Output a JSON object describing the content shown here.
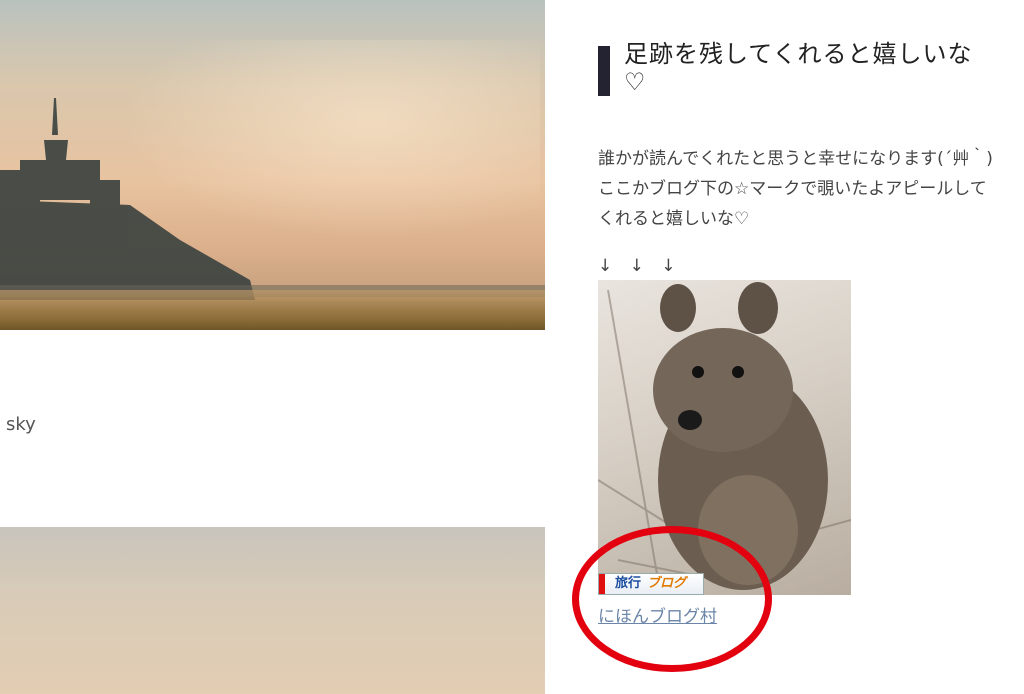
{
  "post": {
    "caption": "sky"
  },
  "sidebar": {
    "title": "足跡を残してくれると嬉しいな♡",
    "paragraph1": "誰かが読んでくれたと思うと幸せになります(´艸｀)",
    "paragraph2": "ここかブログ下の☆マークで覗いたよアピールしてくれると嬉しいな♡",
    "arrows": "↓ ↓ ↓",
    "badge": {
      "part1": "旅行",
      "part2": "ブログ"
    },
    "link_text": "にほんブログ村"
  },
  "colors": {
    "title_bar": "#232331",
    "link": "#6b86a8",
    "highlight_ring": "#e3000f"
  }
}
